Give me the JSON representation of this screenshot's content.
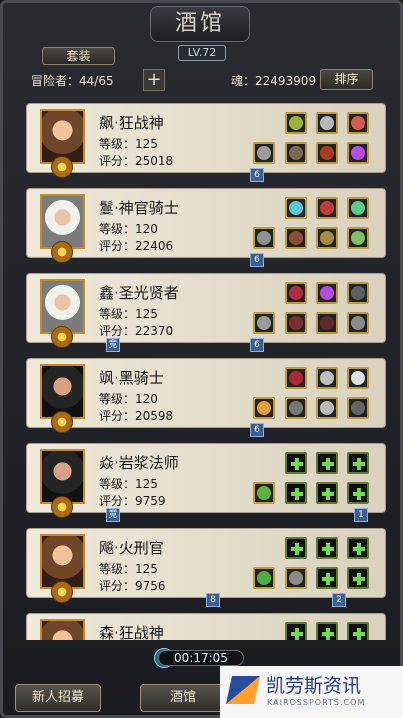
{
  "title": "酒馆",
  "level": "LV.72",
  "top_buttons": {
    "set": "套装",
    "sort": "排序"
  },
  "adventurers": "冒险者：44/65",
  "souls": "魂：22493909",
  "characters": [
    {
      "name": "飙·狂战神",
      "level": "等级：125",
      "score": "评分：25018",
      "badges": [
        "6"
      ]
    },
    {
      "name": "鬘·神官骑士",
      "level": "等级：120",
      "score": "评分：22406",
      "badges": [
        "6"
      ]
    },
    {
      "name": "鑫·圣光贤者",
      "level": "等级：125",
      "score": "评分：22370",
      "badges": [
        "竞",
        "6"
      ]
    },
    {
      "name": "飒·黑骑士",
      "level": "等级：120",
      "score": "评分：20598",
      "badges": [
        "6"
      ]
    },
    {
      "name": "焱·岩浆法师",
      "level": "等级：125",
      "score": "评分：9759",
      "badges": [
        "竞",
        "1"
      ]
    },
    {
      "name": "飚·火刑官",
      "level": "等级：125",
      "score": "评分：9756",
      "badges": [
        "8",
        "2"
      ]
    },
    {
      "name": "森·狂战神",
      "level": "",
      "score": "",
      "badges": []
    }
  ],
  "timer": "00:17:05",
  "bottom": {
    "recruit": "新人招募",
    "tavern": "酒馆"
  },
  "watermark": {
    "brand": "凯劳斯资讯",
    "domain": "KAIROSSPORTS.COM"
  },
  "icons": {
    "plus": "plus-icon",
    "timer": "clock-icon",
    "logo": "kairos-logo-icon"
  }
}
